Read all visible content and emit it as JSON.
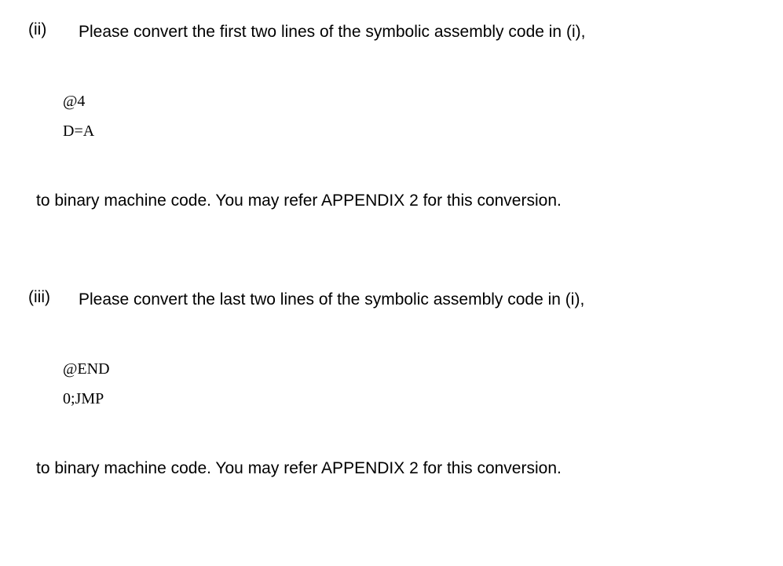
{
  "part_ii": {
    "number": "(ii)",
    "prompt": "Please convert the first two lines of the symbolic assembly code in (i),",
    "code_line1": "@4",
    "code_line2": "D=A",
    "continuation": "to binary machine code. You may refer APPENDIX 2 for this conversion."
  },
  "part_iii": {
    "number": "(iii)",
    "prompt": "Please convert the last two lines of the symbolic assembly code in (i),",
    "code_line1": "@END",
    "code_line2": "0;JMP",
    "continuation": "to binary machine code. You may refer APPENDIX 2 for this conversion."
  }
}
